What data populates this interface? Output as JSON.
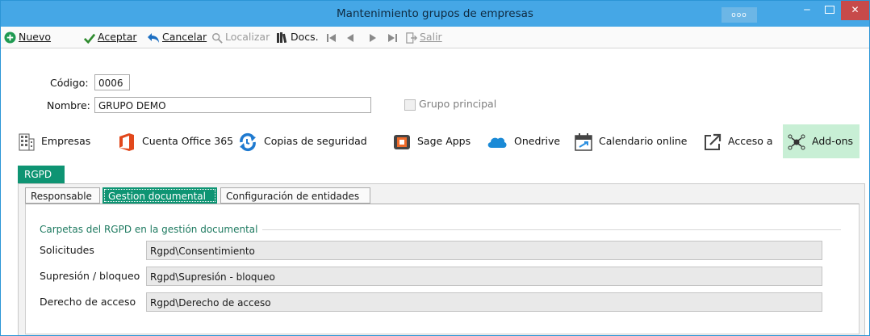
{
  "window": {
    "title": "Mantenimiento grupos de empresas",
    "ellipsis": "ooo",
    "close": "✕"
  },
  "toolbar": {
    "nuevo": "Nuevo",
    "aceptar": "Aceptar",
    "cancelar": "Cancelar",
    "localizar": "Localizar",
    "docs": "Docs.",
    "salir": "Salir"
  },
  "form": {
    "codigo_label": "Código:",
    "codigo_value": "0006",
    "nombre_label": "Nombre:",
    "nombre_value": "GRUPO DEMO",
    "grupo_principal_label": "Grupo principal",
    "grupo_principal_checked": false
  },
  "apps": [
    {
      "label": "Empresas",
      "icon": "building-icon"
    },
    {
      "label": "Cuenta Office 365",
      "icon": "office-icon"
    },
    {
      "label": "Copias de seguridad",
      "icon": "sync-icon"
    },
    {
      "label": "Sage Apps",
      "icon": "sage-apps-icon"
    },
    {
      "label": "Onedrive",
      "icon": "cloud-icon"
    },
    {
      "label": "Calendario online",
      "icon": "calendar-icon"
    },
    {
      "label": "Acceso a",
      "icon": "external-link-icon"
    },
    {
      "label": "Add-ons",
      "icon": "addons-icon"
    }
  ],
  "rgpd_tab": "RGPD",
  "subtabs": [
    "Responsable",
    "Gestion documental",
    "Configuración de entidades"
  ],
  "active_subtab": "Gestion documental",
  "group": {
    "title": "Carpetas del RGPD en la gestión documental",
    "rows": [
      {
        "label": "Solicitudes",
        "value": "Rgpd\\Consentimiento"
      },
      {
        "label": "Supresión / bloqueo",
        "value": "Rgpd\\Supresión - bloqueo"
      },
      {
        "label": "Derecho de acceso",
        "value": "Rgpd\\Derecho de acceso"
      }
    ]
  },
  "colors": {
    "titlebar": "#45a7e6",
    "accent_green": "#0e9473",
    "addons_bg": "#c8efd5",
    "close_btn": "#c74a4a"
  }
}
